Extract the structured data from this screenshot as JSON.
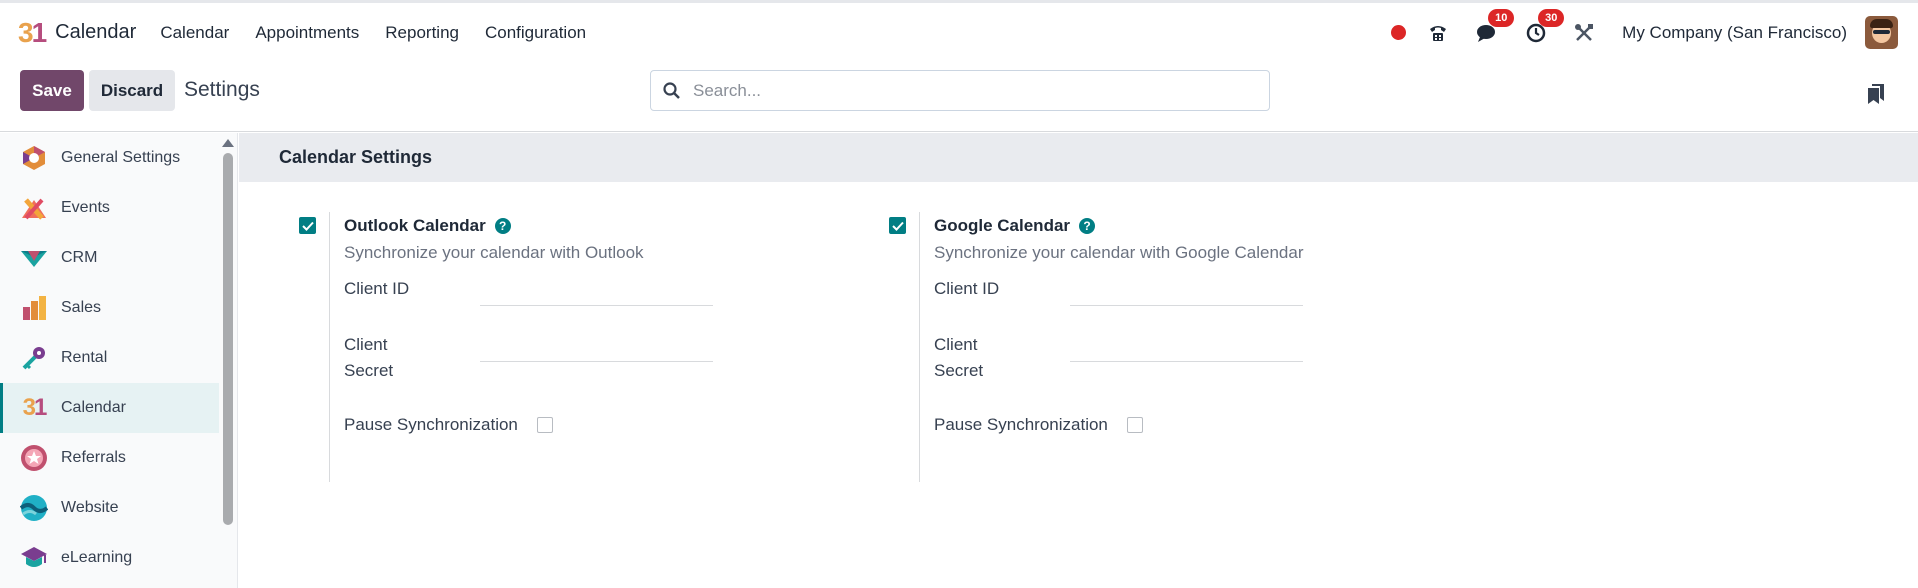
{
  "app": {
    "logo": "31",
    "name": "Calendar"
  },
  "menu": [
    "Calendar",
    "Appointments",
    "Reporting",
    "Configuration"
  ],
  "systray": {
    "messages_count": "10",
    "activities_count": "30",
    "company": "My Company (San Francisco)"
  },
  "control": {
    "save_label": "Save",
    "discard_label": "Discard",
    "title": "Settings",
    "search_placeholder": "Search..."
  },
  "sidebar": {
    "items": [
      {
        "label": "General Settings",
        "icon": "general-settings-icon"
      },
      {
        "label": "Events",
        "icon": "events-icon"
      },
      {
        "label": "CRM",
        "icon": "crm-icon"
      },
      {
        "label": "Sales",
        "icon": "sales-icon"
      },
      {
        "label": "Rental",
        "icon": "rental-icon"
      },
      {
        "label": "Calendar",
        "icon": "calendar-icon",
        "active": true
      },
      {
        "label": "Referrals",
        "icon": "referrals-icon"
      },
      {
        "label": "Website",
        "icon": "website-icon"
      },
      {
        "label": "eLearning",
        "icon": "elearning-icon"
      }
    ]
  },
  "section": {
    "title": "Calendar Settings",
    "outlook": {
      "title": "Outlook Calendar",
      "description": "Synchronize your calendar with Outlook",
      "client_id_label": "Client ID",
      "client_secret_label_1": "Client",
      "client_secret_label_2": "Secret",
      "pause_label": "Pause Synchronization",
      "enabled": true,
      "paused": false
    },
    "google": {
      "title": "Google Calendar",
      "description": "Synchronize your calendar with Google Calendar",
      "client_id_label": "Client ID",
      "client_secret_label_1": "Client",
      "client_secret_label_2": "Secret",
      "pause_label": "Pause Synchronization",
      "enabled": true,
      "paused": false
    }
  },
  "colors": {
    "primary": "#71476a",
    "accent": "#017e84",
    "alert": "#dc2626"
  }
}
